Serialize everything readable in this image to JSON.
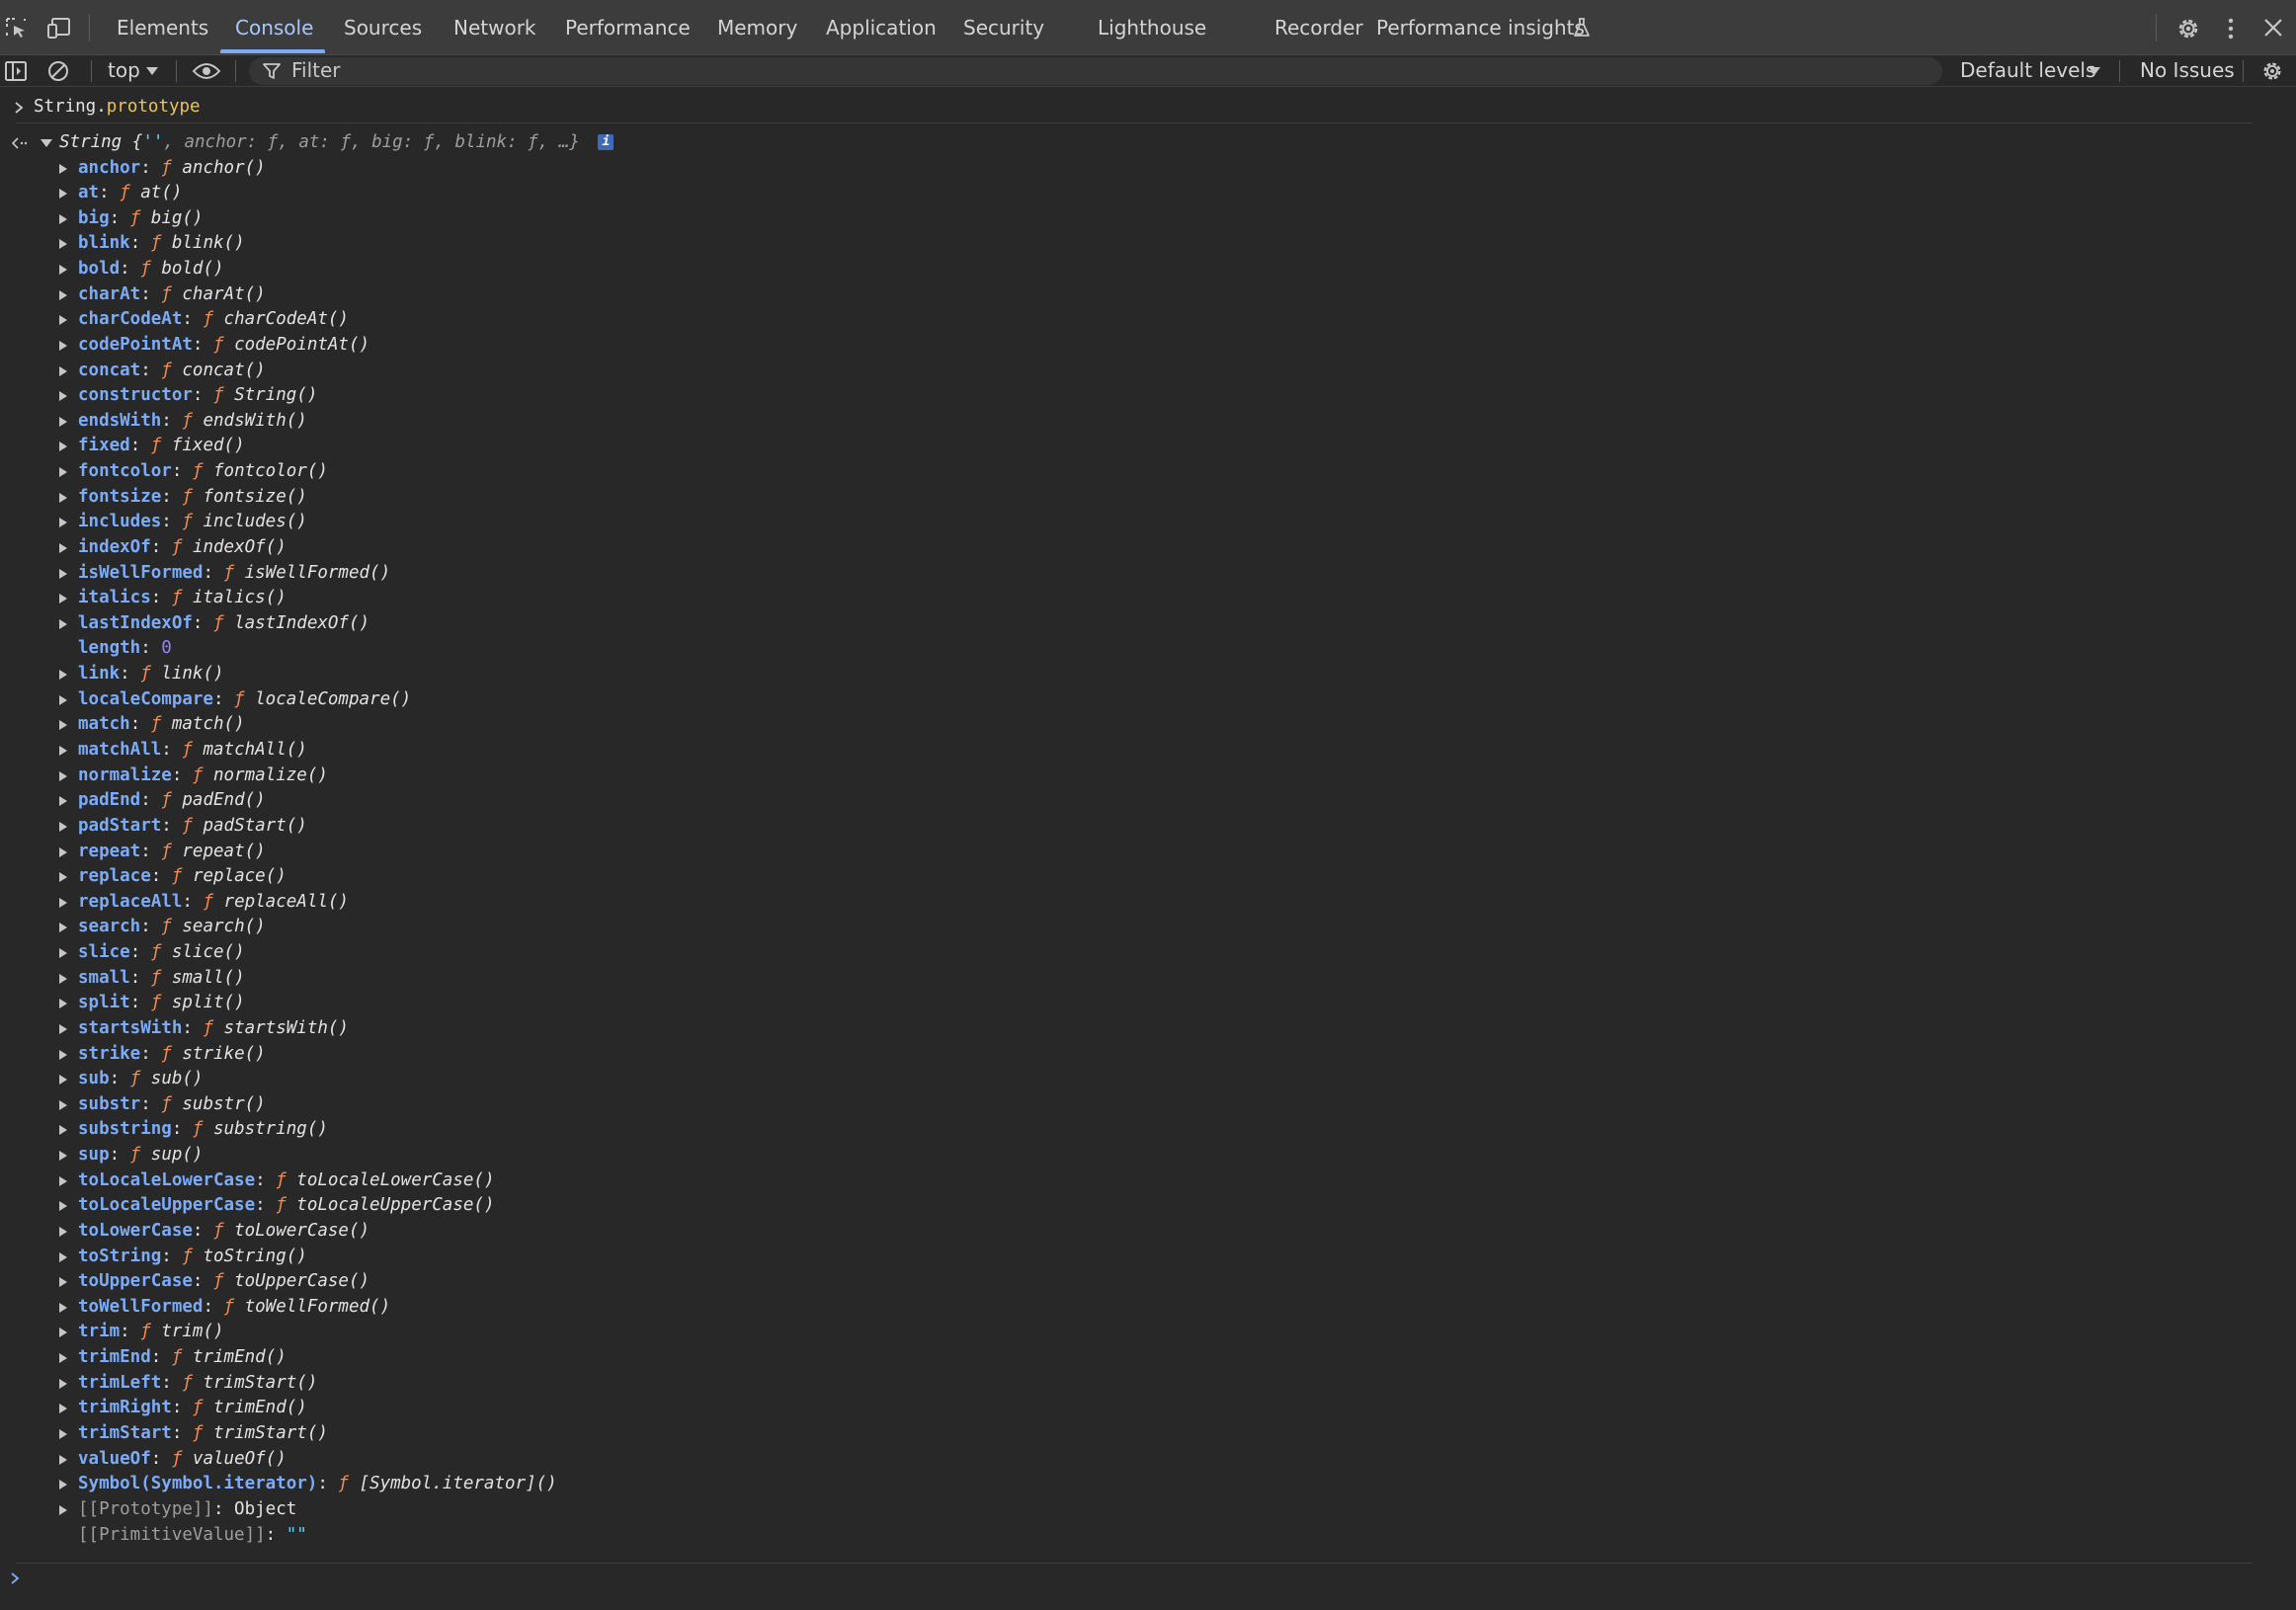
{
  "tabs": [
    {
      "label": "Elements",
      "active": false
    },
    {
      "label": "Console",
      "active": true
    },
    {
      "label": "Sources",
      "active": false
    },
    {
      "label": "Network",
      "active": false
    },
    {
      "label": "Performance",
      "active": false
    },
    {
      "label": "Memory",
      "active": false
    },
    {
      "label": "Application",
      "active": false
    },
    {
      "label": "Security",
      "active": false
    },
    {
      "label": "Lighthouse",
      "active": false
    },
    {
      "label": "Recorder",
      "active": false
    },
    {
      "label": "Performance insights",
      "active": false
    }
  ],
  "toolbar": {
    "context": "top",
    "filter_placeholder": "Filter",
    "levels": "Default levels",
    "issues": "No Issues"
  },
  "console": {
    "input_expr": "String",
    "input_prop": "prototype",
    "summary_type": "String",
    "summary_open": "{",
    "summary_str": "''",
    "summary_rest": ", anchor: ƒ, at: ƒ, big: ƒ, blink: ƒ, …}",
    "info_badge": "i",
    "f_marker": "ƒ",
    "properties": [
      {
        "key": "anchor",
        "value": "anchor()"
      },
      {
        "key": "at",
        "value": "at()"
      },
      {
        "key": "big",
        "value": "big()"
      },
      {
        "key": "blink",
        "value": "blink()"
      },
      {
        "key": "bold",
        "value": "bold()"
      },
      {
        "key": "charAt",
        "value": "charAt()"
      },
      {
        "key": "charCodeAt",
        "value": "charCodeAt()"
      },
      {
        "key": "codePointAt",
        "value": "codePointAt()"
      },
      {
        "key": "concat",
        "value": "concat()"
      },
      {
        "key": "constructor",
        "value": "String()"
      },
      {
        "key": "endsWith",
        "value": "endsWith()"
      },
      {
        "key": "fixed",
        "value": "fixed()"
      },
      {
        "key": "fontcolor",
        "value": "fontcolor()"
      },
      {
        "key": "fontsize",
        "value": "fontsize()"
      },
      {
        "key": "includes",
        "value": "includes()"
      },
      {
        "key": "indexOf",
        "value": "indexOf()"
      },
      {
        "key": "isWellFormed",
        "value": "isWellFormed()"
      },
      {
        "key": "italics",
        "value": "italics()"
      },
      {
        "key": "lastIndexOf",
        "value": "lastIndexOf()"
      },
      {
        "key": "length",
        "value": "0",
        "kind": "number"
      },
      {
        "key": "link",
        "value": "link()"
      },
      {
        "key": "localeCompare",
        "value": "localeCompare()"
      },
      {
        "key": "match",
        "value": "match()"
      },
      {
        "key": "matchAll",
        "value": "matchAll()"
      },
      {
        "key": "normalize",
        "value": "normalize()"
      },
      {
        "key": "padEnd",
        "value": "padEnd()"
      },
      {
        "key": "padStart",
        "value": "padStart()"
      },
      {
        "key": "repeat",
        "value": "repeat()"
      },
      {
        "key": "replace",
        "value": "replace()"
      },
      {
        "key": "replaceAll",
        "value": "replaceAll()"
      },
      {
        "key": "search",
        "value": "search()"
      },
      {
        "key": "slice",
        "value": "slice()"
      },
      {
        "key": "small",
        "value": "small()"
      },
      {
        "key": "split",
        "value": "split()"
      },
      {
        "key": "startsWith",
        "value": "startsWith()"
      },
      {
        "key": "strike",
        "value": "strike()"
      },
      {
        "key": "sub",
        "value": "sub()"
      },
      {
        "key": "substr",
        "value": "substr()"
      },
      {
        "key": "substring",
        "value": "substring()"
      },
      {
        "key": "sup",
        "value": "sup()"
      },
      {
        "key": "toLocaleLowerCase",
        "value": "toLocaleLowerCase()"
      },
      {
        "key": "toLocaleUpperCase",
        "value": "toLocaleUpperCase()"
      },
      {
        "key": "toLowerCase",
        "value": "toLowerCase()"
      },
      {
        "key": "toString",
        "value": "toString()"
      },
      {
        "key": "toUpperCase",
        "value": "toUpperCase()"
      },
      {
        "key": "toWellFormed",
        "value": "toWellFormed()"
      },
      {
        "key": "trim",
        "value": "trim()"
      },
      {
        "key": "trimEnd",
        "value": "trimEnd()"
      },
      {
        "key": "trimLeft",
        "value": "trimStart()"
      },
      {
        "key": "trimRight",
        "value": "trimEnd()"
      },
      {
        "key": "trimStart",
        "value": "trimStart()"
      },
      {
        "key": "valueOf",
        "value": "valueOf()"
      },
      {
        "key": "Symbol(Symbol.iterator)",
        "value": "[Symbol.iterator]()"
      },
      {
        "key": "[[Prototype]]",
        "value": "Object",
        "kind": "internal"
      },
      {
        "key": "[[PrimitiveValue]]",
        "value": "\"\"",
        "kind": "internal-string"
      }
    ]
  },
  "colors": {
    "accent": "#7cacf8",
    "key": "#7cacf8",
    "function_marker": "#f28b54",
    "number": "#9980ff",
    "string": "#5cd5fb",
    "background": "#282828"
  }
}
